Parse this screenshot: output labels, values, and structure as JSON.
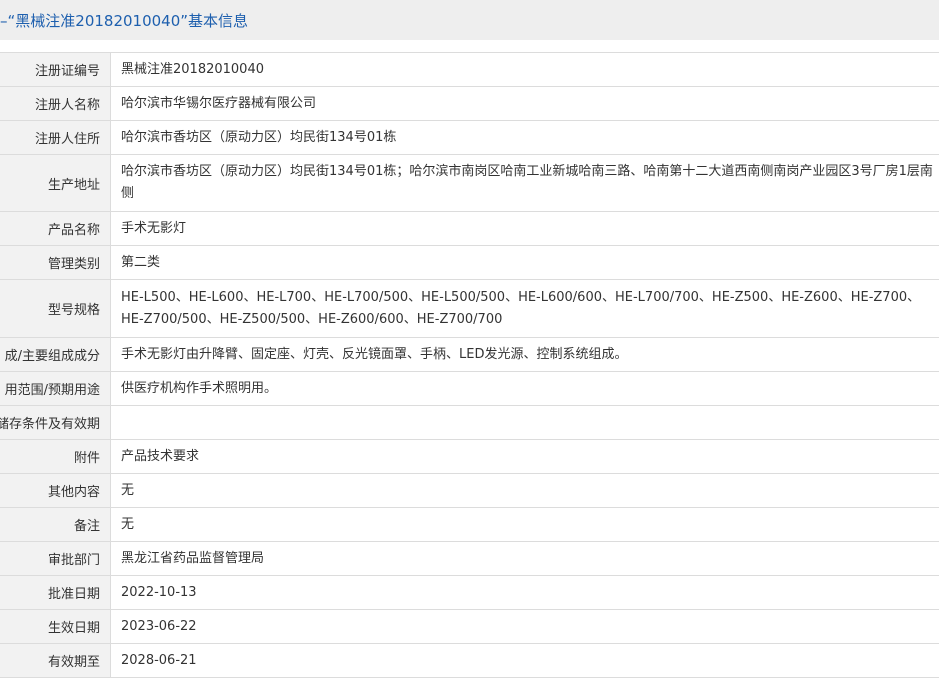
{
  "header": {
    "title": "–“黑械注准20182010040”基本信息"
  },
  "rows": [
    {
      "label": "注册证编号",
      "value": "黑械注准20182010040"
    },
    {
      "label": "注册人名称",
      "value": "哈尔滨市华锡尔医疗器械有限公司"
    },
    {
      "label": "注册人住所",
      "value": "哈尔滨市香坊区（原动力区）均民街134号01栋"
    },
    {
      "label": "生产地址",
      "value": "哈尔滨市香坊区（原动力区）均民街134号01栋；哈尔滨市南岗区哈南工业新城哈南三路、哈南第十二大道西南侧南岗产业园区3号厂房1层南侧"
    },
    {
      "label": "产品名称",
      "value": "手术无影灯"
    },
    {
      "label": "管理类别",
      "value": "第二类"
    },
    {
      "label": "型号规格",
      "value": "HE-L500、HE-L600、HE-L700、HE-L700/500、HE-L500/500、HE-L600/600、HE-L700/700、HE-Z500、HE-Z600、HE-Z700、HE-Z700/500、HE-Z500/500、HE-Z600/600、HE-Z700/700"
    },
    {
      "label": "成/主要组成成分",
      "value": "手术无影灯由升降臂、固定座、灯壳、反光镜面罩、手柄、LED发光源、控制系统组成。"
    },
    {
      "label": "用范围/预期用途",
      "value": "供医疗机构作手术照明用。"
    },
    {
      "label": "储存条件及有效期",
      "value": ""
    },
    {
      "label": "附件",
      "value": "产品技术要求"
    },
    {
      "label": "其他内容",
      "value": "无"
    },
    {
      "label": "备注",
      "value": "无"
    },
    {
      "label": "审批部门",
      "value": "黑龙江省药品监督管理局"
    },
    {
      "label": "批准日期",
      "value": "2022-10-13"
    },
    {
      "label": "生效日期",
      "value": "2023-06-22"
    },
    {
      "label": "有效期至",
      "value": "2028-06-21"
    }
  ]
}
